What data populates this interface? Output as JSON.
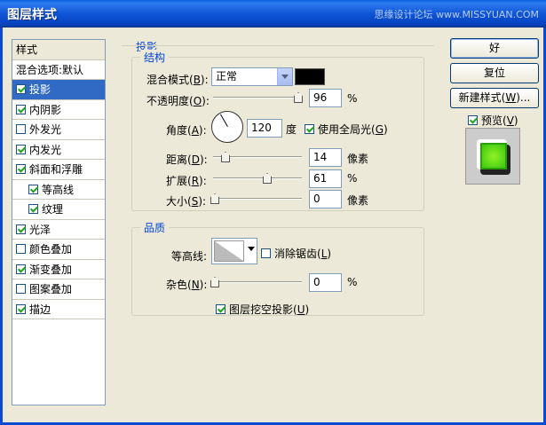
{
  "window": {
    "title": "图层样式",
    "watermark": "思缘设计论坛 www.MISSYUAN.COM"
  },
  "styles_list": [
    {
      "label": "样式",
      "checked": null
    },
    {
      "label": "混合选项:默认",
      "checked": null
    },
    {
      "label": "投影",
      "checked": true,
      "selected": true
    },
    {
      "label": "内阴影",
      "checked": true
    },
    {
      "label": "外发光",
      "checked": false
    },
    {
      "label": "内发光",
      "checked": true
    },
    {
      "label": "斜面和浮雕",
      "checked": true
    },
    {
      "label": "等高线",
      "checked": true,
      "sub": true
    },
    {
      "label": "纹理",
      "checked": true,
      "sub": true
    },
    {
      "label": "光泽",
      "checked": true
    },
    {
      "label": "颜色叠加",
      "checked": false
    },
    {
      "label": "渐变叠加",
      "checked": true
    },
    {
      "label": "图案叠加",
      "checked": false
    },
    {
      "label": "描边",
      "checked": true
    }
  ],
  "panel": {
    "title": "投影",
    "structure": {
      "legend": "结构",
      "blend_mode_label": "混合模式(",
      "blend_mode_key": "B",
      "blend_mode_value": "正常",
      "color": "#000000",
      "opacity_label": "不透明度(",
      "opacity_key": "O",
      "opacity_value": "96",
      "opacity_unit": "%",
      "angle_label": "角度(",
      "angle_key": "A",
      "angle_value": "120",
      "angle_unit": "度",
      "global_light_label": "使用全局光(",
      "global_light_key": "G",
      "global_light_checked": true,
      "distance_label": "距离(",
      "distance_key": "D",
      "distance_value": "14",
      "distance_unit": "像素",
      "spread_label": "扩展(",
      "spread_key": "R",
      "spread_value": "61",
      "spread_unit": "%",
      "size_label": "大小(",
      "size_key": "S",
      "size_value": "0",
      "size_unit": "像素"
    },
    "quality": {
      "legend": "品质",
      "contour_label": "等高线:",
      "antialias_label": "消除锯齿(",
      "antialias_key": "L",
      "antialias_checked": false,
      "noise_label": "杂色(",
      "noise_key": "N",
      "noise_value": "0",
      "noise_unit": "%"
    },
    "knockout_label": "图层挖空投影(",
    "knockout_key": "U",
    "knockout_checked": true
  },
  "buttons": {
    "ok": "好",
    "reset": "复位",
    "new_style_label": "新建样式(",
    "new_style_key": "W",
    "new_style_suffix": ")...",
    "preview_label": "预览(",
    "preview_key": "V",
    "preview_checked": true
  },
  "close_paren": ")",
  "close_paren_colon": "):"
}
